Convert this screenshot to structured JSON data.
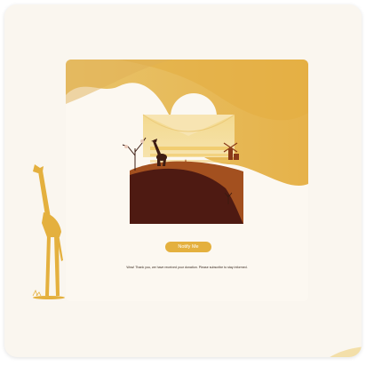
{
  "card": {
    "notify_button_label": "Notify Me",
    "message": "Wow! Thank you, we have received your donation. Please subscribe to stay informed."
  },
  "illustration": {
    "icon": "envelope-savanna-illustration",
    "colors": {
      "gold": "#e4b03e",
      "dark_brown": "#4e1a12",
      "rust": "#a3501f",
      "cream": "#fcf8f1"
    }
  },
  "decorations": {
    "left_figure_icon": "giraffe-icon"
  }
}
